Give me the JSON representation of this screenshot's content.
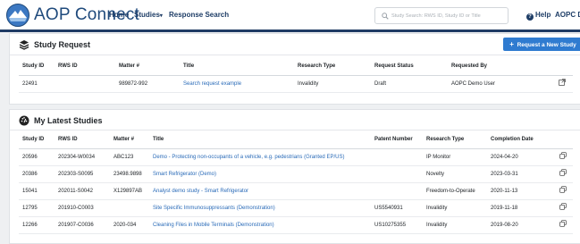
{
  "app": {
    "brand": "AOP Connect",
    "accent_color": "#1f3b64",
    "link_color": "#2a6bb8",
    "button_color": "#2f7bd0"
  },
  "nav": {
    "home": "Home",
    "studies": "Studies",
    "response_search": "Response Search",
    "search_placeholder": "Study Search: RWS ID, Study ID or Title",
    "help": "Help",
    "user": "AOPC Demo"
  },
  "study_request": {
    "title": "Study Request",
    "new_button": "Request a New Study",
    "columns": [
      "Study ID",
      "RWS ID",
      "Matter #",
      "Title",
      "Research Type",
      "Request Status",
      "Requested By"
    ],
    "rows": [
      {
        "study_id": "22491",
        "rws_id": "",
        "matter": "989872-992",
        "title": "Search request example",
        "research_type": "Invalidity",
        "status": "Draft",
        "requested_by": "AOPC Demo User",
        "action_icon": "external-link-icon"
      }
    ]
  },
  "latest_studies": {
    "title": "My Latest Studies",
    "columns": [
      "Study ID",
      "RWS ID",
      "Matter #",
      "Title",
      "Patent Number",
      "Research Type",
      "Completion Date"
    ],
    "rows": [
      {
        "study_id": "20596",
        "rws_id": "202304-W0034",
        "matter": "ABC123",
        "title": "Demo - Protecting non-occupants of a vehicle, e.g. pedestrians (Granted EP/US)",
        "patent": "",
        "research_type": "IP Monitor",
        "date": "2024-04-20",
        "action_icon": "copy-icon"
      },
      {
        "study_id": "20386",
        "rws_id": "202303-S0095",
        "matter": "23498.9898",
        "title": "Smart Refrigerator (Demo)",
        "patent": "",
        "research_type": "Novelty",
        "date": "2023-03-31",
        "action_icon": "copy-icon"
      },
      {
        "study_id": "15041",
        "rws_id": "202011-S0042",
        "matter": "X129897AB",
        "title": "Analyst demo study - Smart Refrigerator",
        "patent": "",
        "research_type": "Freedom-to-Operate",
        "date": "2020-11-13",
        "action_icon": "copy-icon"
      },
      {
        "study_id": "12795",
        "rws_id": "201910-C0003",
        "matter": "",
        "title": "Site Specific Immunosuppressants (Demonstration)",
        "patent": "US5540931",
        "research_type": "Invalidity",
        "date": "2019-11-18",
        "action_icon": "copy-icon"
      },
      {
        "study_id": "12266",
        "rws_id": "201907-C0036",
        "matter": "2020-034",
        "title": "Cleaning Files in Mobile Terminals (Demonstration)",
        "patent": "US10275355",
        "research_type": "Invalidity",
        "date": "2019-08-20",
        "action_icon": "copy-icon"
      }
    ]
  }
}
